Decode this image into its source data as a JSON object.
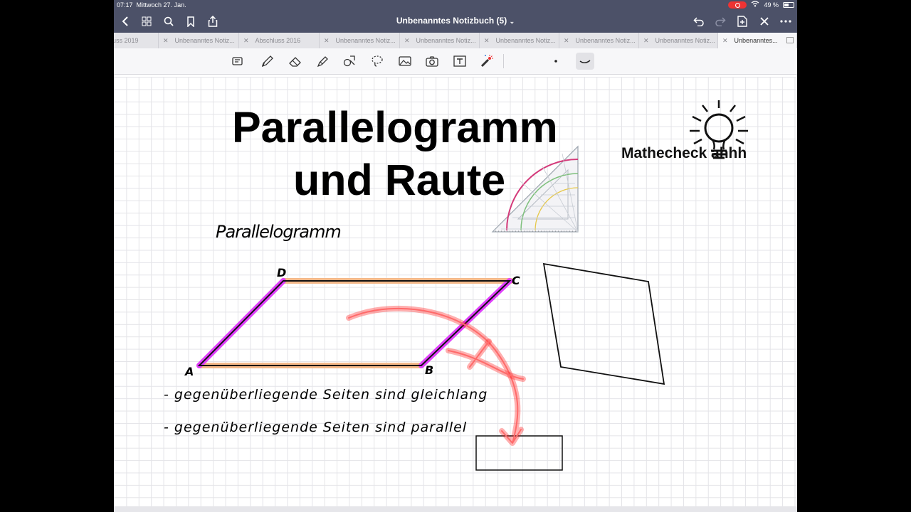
{
  "status": {
    "time": "07:17",
    "date": "Mittwoch 27. Jan.",
    "battery": "49 %"
  },
  "nav": {
    "title": "Unbenanntes Notizbuch (5)",
    "caret": "⌄"
  },
  "tabs": [
    {
      "label": "uss 2019",
      "closable": false
    },
    {
      "label": "Unbenanntes Notiz...",
      "closable": true
    },
    {
      "label": "Abschluss 2016",
      "closable": true
    },
    {
      "label": "Unbenanntes Notiz...",
      "closable": true
    },
    {
      "label": "Unbenanntes Notiz...",
      "closable": true
    },
    {
      "label": "Unbenanntes Notiz...",
      "closable": true
    },
    {
      "label": "Unbenanntes Notiz...",
      "closable": true
    },
    {
      "label": "Unbenanntes Notiz...",
      "closable": true
    },
    {
      "label": "Unbenanntes...",
      "closable": true,
      "active": true
    }
  ],
  "tools": [
    "keyboard-mode",
    "pen",
    "eraser",
    "highlighter",
    "shapes",
    "lasso",
    "image",
    "camera",
    "text",
    "laser-pointer",
    "stroke-dot",
    "stroke-curve"
  ],
  "note": {
    "title_line1": "Parallelogramm",
    "title_line2": "und Raute",
    "brand": "Mathecheck ahhh",
    "heading": "Parallelogramm",
    "vertices": {
      "a": "A",
      "b": "B",
      "c": "C",
      "d": "D"
    },
    "bullet1": "- gegenüberliegende Seiten sind gleichlang",
    "bullet2": "- gegenüberliegende Seiten sind parallel"
  },
  "colors": {
    "chrome": "#4c5168",
    "magenta": "#e040fb",
    "orange": "#f4b98a",
    "laser": "#ff1a1a"
  }
}
